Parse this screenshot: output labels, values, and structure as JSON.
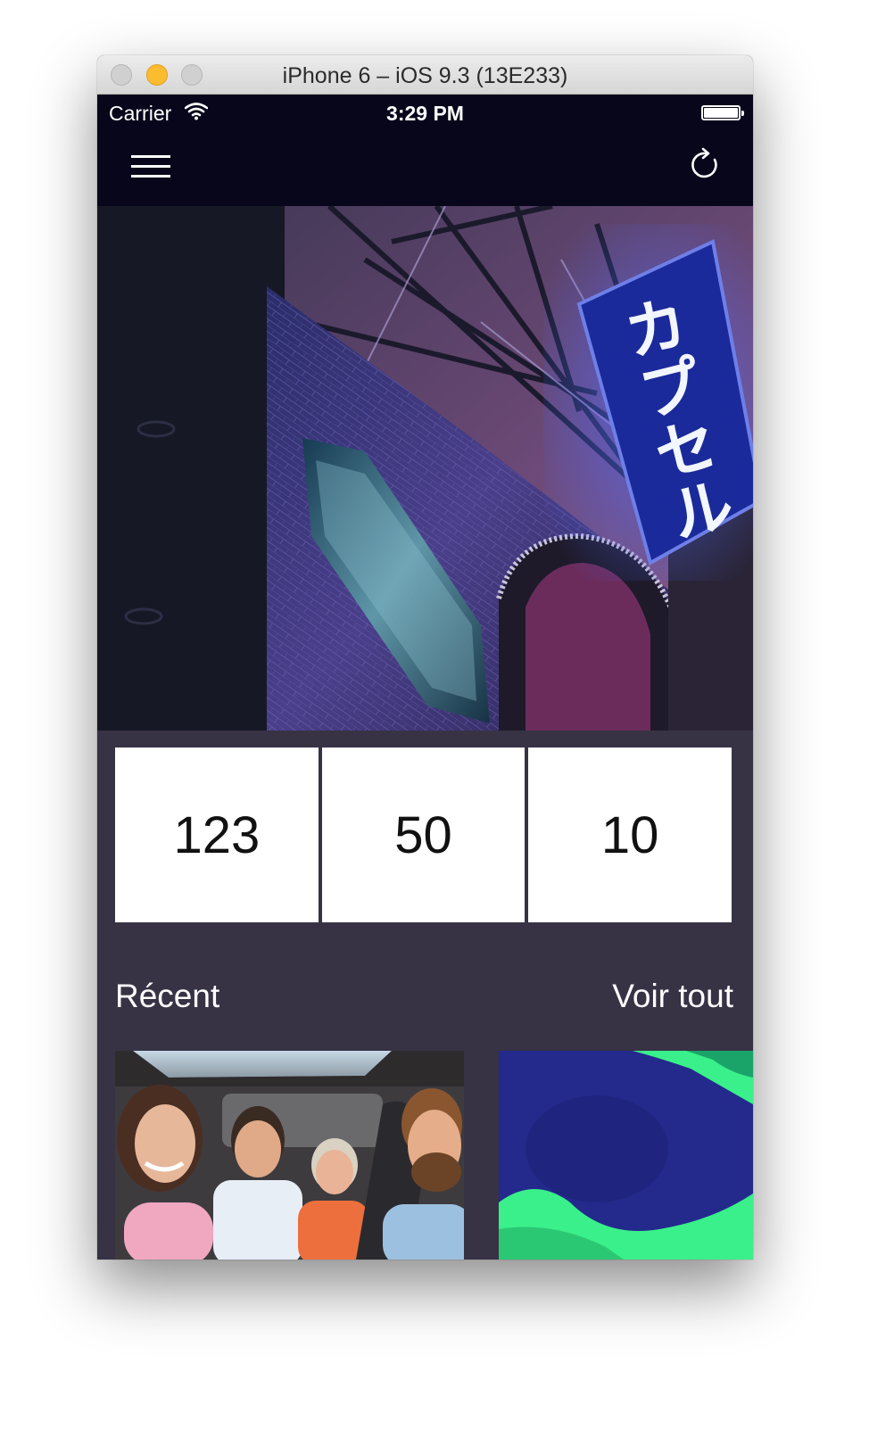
{
  "window": {
    "title": "iPhone 6 – iOS 9.3 (13E233)"
  },
  "status_bar": {
    "carrier": "Carrier",
    "time": "3:29 PM"
  },
  "nav": {
    "menu_icon": "hamburger-menu-icon",
    "refresh_icon": "refresh-icon"
  },
  "hero": {
    "sign_text": "カプセル"
  },
  "stats": [
    {
      "value": "123"
    },
    {
      "value": "50"
    },
    {
      "value": "10"
    }
  ],
  "recent": {
    "title": "Récent",
    "see_all": "Voir tout"
  },
  "colors": {
    "navbar": "#07061b",
    "background": "#373345",
    "card": "#ffffff",
    "neon_sign": "#1b2a9a",
    "accent_green": "#3af08a",
    "accent_blue": "#232a8c"
  }
}
